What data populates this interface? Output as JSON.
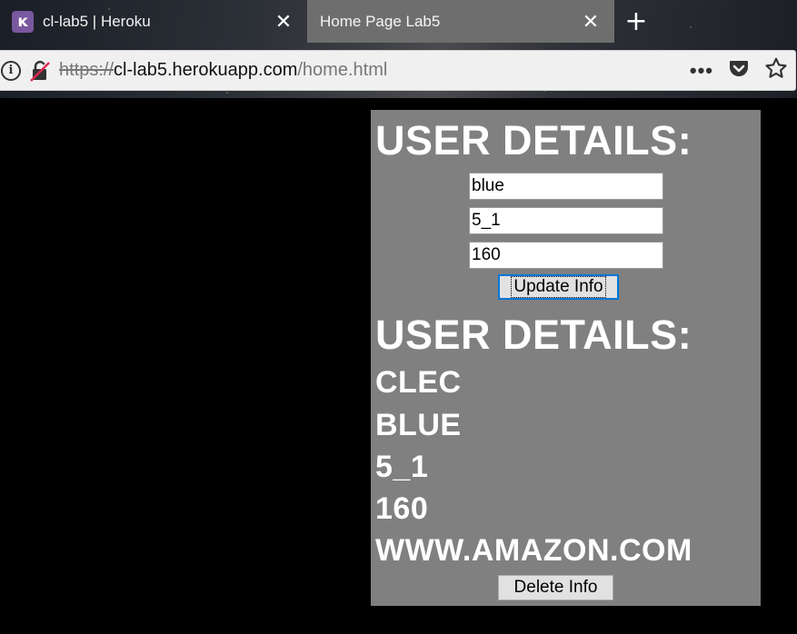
{
  "browser": {
    "tabs": [
      {
        "title": "cl-lab5 | Heroku",
        "favicon": "heroku-icon",
        "favicon_glyph": "ĸ",
        "close": "✕",
        "active": false
      },
      {
        "title": "Home Page Lab5",
        "close": "✕",
        "active": true
      }
    ],
    "new_tab": "+",
    "url": {
      "scheme": "https://",
      "host": "cl-lab5.herokuapp.com",
      "path": "/home.html"
    },
    "actions": {
      "more": "•••",
      "icons": [
        "info-icon",
        "insecure-lock-icon",
        "more-icon",
        "pocket-icon",
        "bookmark-star-icon"
      ]
    }
  },
  "form": {
    "heading": "USER DETAILS:",
    "fields": [
      {
        "value": "blue"
      },
      {
        "value": "5_1"
      },
      {
        "value": "160"
      }
    ],
    "update_label": "Update Info"
  },
  "details": {
    "heading": "USER DETAILS:",
    "lines": [
      "CLEC",
      "BLUE",
      "5_1",
      "160",
      "WWW.AMAZON.COM"
    ],
    "delete_label": "Delete Info"
  },
  "colors": {
    "page_background": "#000000",
    "panel_background": "#808080",
    "text": "#ffffff",
    "focus_border": "#0078d7"
  }
}
